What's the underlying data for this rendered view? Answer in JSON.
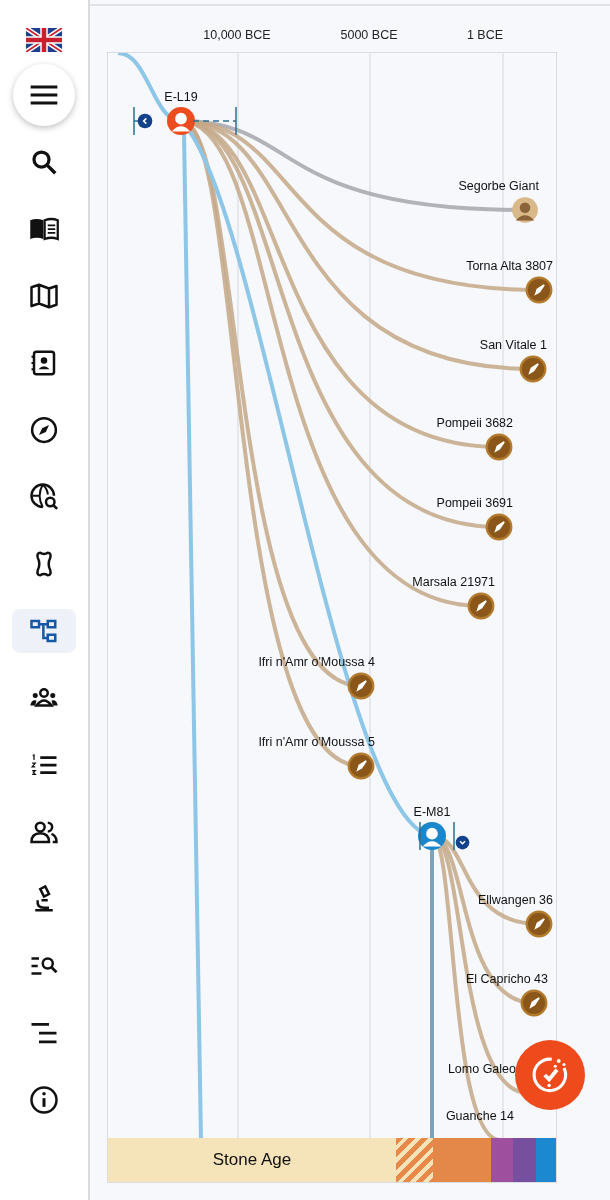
{
  "sidebar": {
    "items": [
      {
        "selected": false
      },
      {
        "selected": false
      },
      {
        "selected": false
      },
      {
        "selected": false
      },
      {
        "selected": false
      },
      {
        "selected": false
      },
      {
        "selected": false
      },
      {
        "selected": true
      },
      {
        "selected": false
      },
      {
        "selected": false
      },
      {
        "selected": false
      },
      {
        "selected": false
      },
      {
        "selected": false
      },
      {
        "selected": false
      },
      {
        "selected": false
      }
    ]
  },
  "axis": {
    "ticks": [
      "10,000 BCE",
      "5000 BCE",
      "1 BCE"
    ]
  },
  "tree": {
    "name": "E-L19",
    "kind": "haplogroup",
    "color": "#ec4c1e",
    "expanded": false,
    "children": [
      {
        "name": "Segorbe Giant",
        "kind": "portrait"
      },
      {
        "name": "Torna Alta 3807",
        "kind": "sample"
      },
      {
        "name": "San Vitale 1",
        "kind": "sample"
      },
      {
        "name": "Pompeii 3682",
        "kind": "sample"
      },
      {
        "name": "Pompeii 3691",
        "kind": "sample"
      },
      {
        "name": "Marsala 21971",
        "kind": "sample"
      },
      {
        "name": "Ifri n'Amr o'Moussa 4",
        "kind": "sample"
      },
      {
        "name": "Ifri n'Amr o'Moussa 5",
        "kind": "sample"
      },
      {
        "name": "E-M81",
        "kind": "haplogroup",
        "color": "#1a86cc",
        "expanded": true,
        "children": [
          {
            "name": "Ellwangen 36",
            "kind": "sample"
          },
          {
            "name": "El Capricho 43",
            "kind": "sample"
          },
          {
            "name": "Lomo Galeo",
            "kind": "covered"
          },
          {
            "name": "Guanche 14",
            "kind": "covered"
          }
        ]
      }
    ]
  },
  "eras": [
    {
      "label": "Stone Age",
      "kind": "solid",
      "color": "#f5e3b9"
    },
    {
      "kind": "hatched",
      "color": "#e8894a"
    },
    {
      "kind": "solid",
      "color": "#e4884a"
    },
    {
      "kind": "solid",
      "color": "#9e4f9d"
    },
    {
      "kind": "solid",
      "color": "#76509e"
    },
    {
      "kind": "solid",
      "color": "#1b88d0"
    }
  ]
}
